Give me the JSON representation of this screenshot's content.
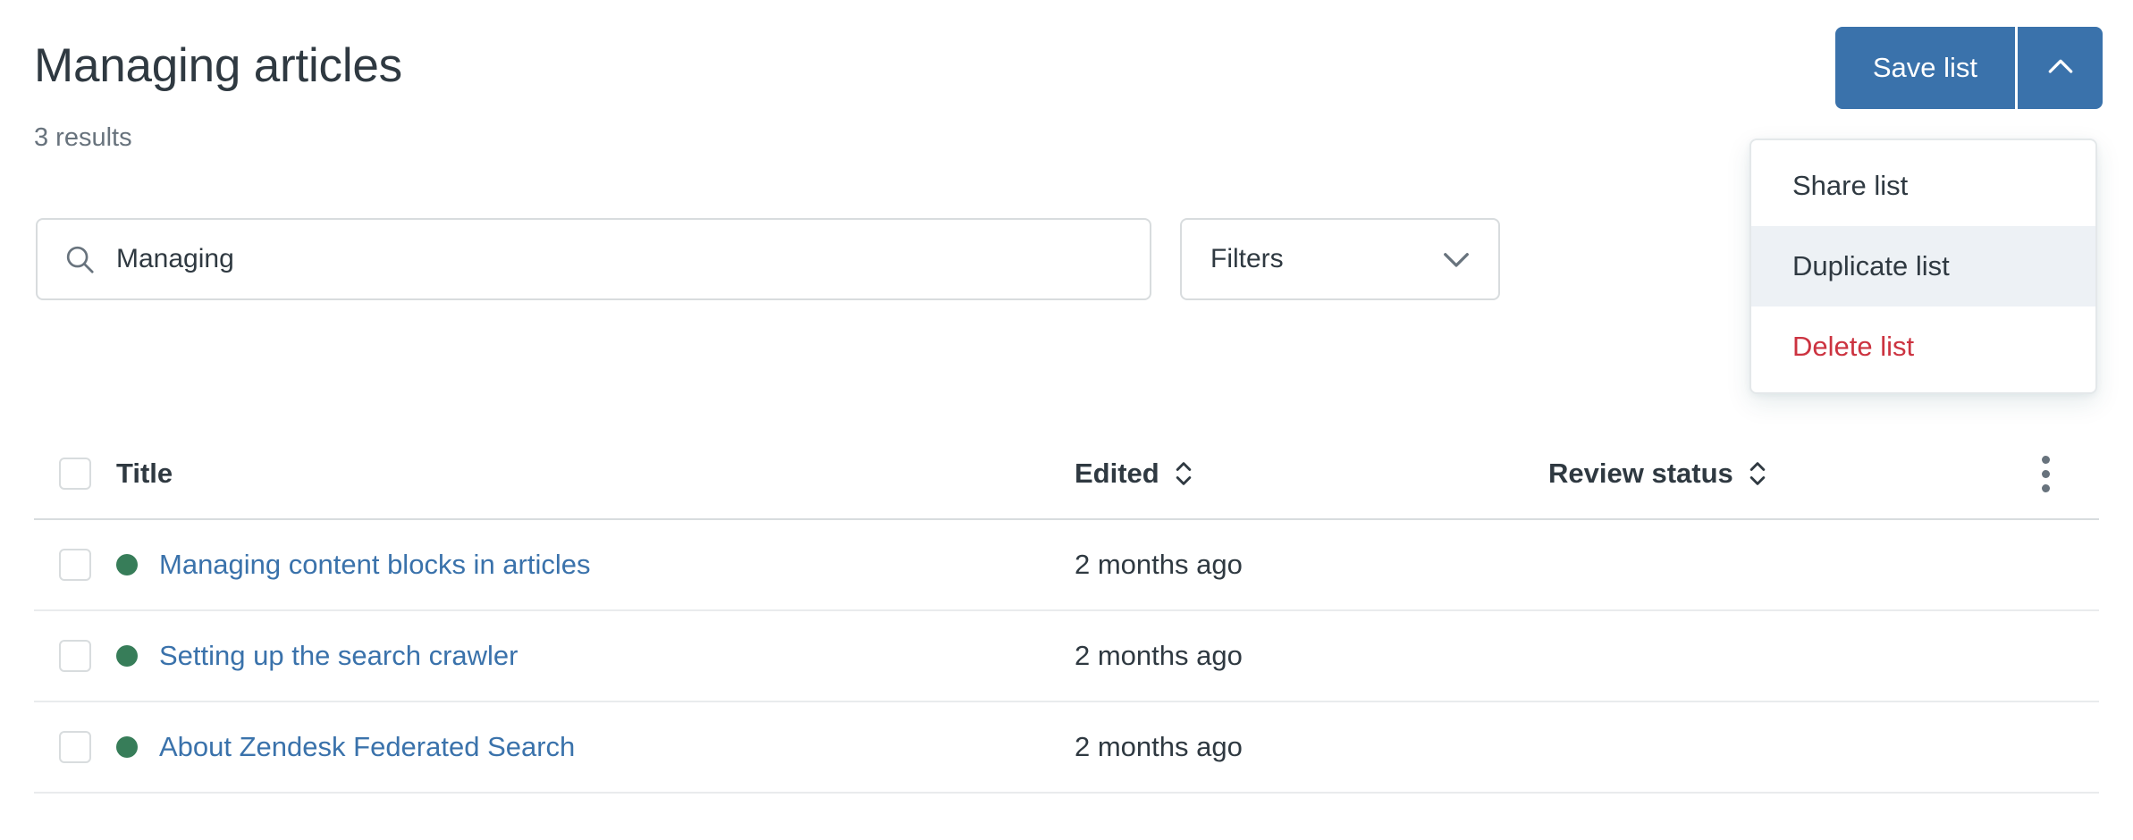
{
  "header": {
    "title": "Managing articles",
    "results": "3 results"
  },
  "search": {
    "value": "Managing",
    "placeholder": "Search",
    "icon": "search-icon"
  },
  "filters": {
    "label": "Filters",
    "icon": "chevron-down-icon"
  },
  "save": {
    "label": "Save list",
    "caret_icon": "chevron-up-icon",
    "accent_color": "#3a72ab"
  },
  "menu": {
    "items": [
      {
        "label": "Share list",
        "state": "default"
      },
      {
        "label": "Duplicate list",
        "state": "highlighted"
      },
      {
        "label": "Delete list",
        "state": "danger"
      }
    ],
    "highlight_color": "#edf1f5",
    "danger_color": "#cc3340"
  },
  "table": {
    "columns": {
      "title": "Title",
      "edited": "Edited",
      "review_status": "Review status"
    },
    "sort_icon": "sort-updown-icon",
    "overflow_icon": "kebab-menu-icon",
    "select_all_checkbox": "checkbox-unchecked",
    "status_dot_color": "#377d59",
    "link_color": "#3a72ab",
    "rows": [
      {
        "title": "Managing content blocks in articles",
        "edited": "2 months ago",
        "review_status": "",
        "status_dot": "published-green"
      },
      {
        "title": "Setting up the search crawler",
        "edited": "2 months ago",
        "review_status": "",
        "status_dot": "published-green"
      },
      {
        "title": "About Zendesk Federated Search",
        "edited": "2 months ago",
        "review_status": "",
        "status_dot": "published-green"
      }
    ]
  }
}
